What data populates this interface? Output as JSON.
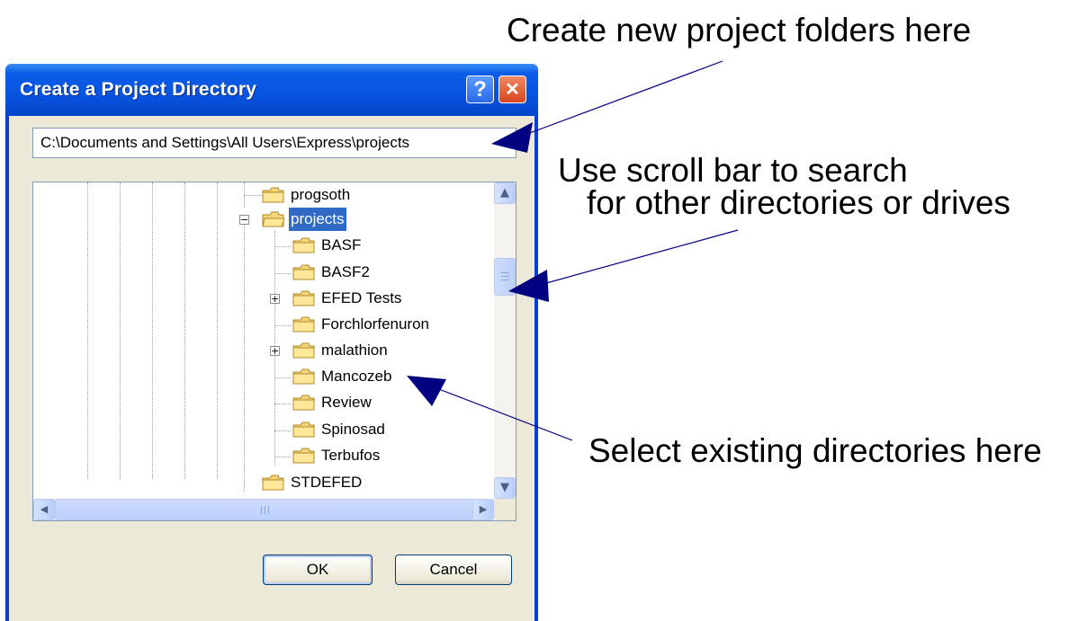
{
  "annotations": {
    "create_folders": "Create new project folders here",
    "scroll_line1": "Use scroll bar to search",
    "scroll_line2": "for other directories or drives",
    "select_existing": "Select existing directories here"
  },
  "dialog": {
    "title": "Create a Project Directory",
    "help_label": "?",
    "close_label": "✕",
    "path_value": "C:\\Documents and Settings\\All Users\\Express\\projects",
    "ok_label": "OK",
    "cancel_label": "Cancel"
  },
  "tree": {
    "items": [
      {
        "label": "progsoth"
      },
      {
        "label": "projects",
        "selected": true,
        "expanded": true
      },
      {
        "label": "BASF"
      },
      {
        "label": "BASF2"
      },
      {
        "label": "EFED Tests",
        "collapsed": true
      },
      {
        "label": "Forchlorfenuron"
      },
      {
        "label": "malathion",
        "collapsed": true
      },
      {
        "label": "Mancozeb"
      },
      {
        "label": "Review"
      },
      {
        "label": "Spinosad"
      },
      {
        "label": "Terbufos"
      },
      {
        "label": "STDEFED"
      }
    ]
  },
  "scrollbar": {
    "up_arrow": "▲",
    "down_arrow": "▼",
    "left_arrow": "◀",
    "right_arrow": "▶"
  },
  "colors": {
    "titlebar": "#0853df",
    "selection": "#316ac5",
    "dialog_face": "#ece9d8",
    "arrow": "#000080"
  }
}
